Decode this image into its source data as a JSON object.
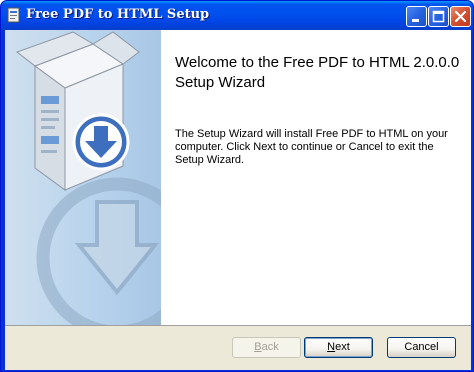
{
  "window": {
    "title": "Free PDF to HTML Setup"
  },
  "icons": {
    "app": "installer-icon",
    "minimize": "minimize-icon",
    "maximize": "maximize-icon",
    "close": "close-icon",
    "banner": "package-download-icon"
  },
  "welcome": {
    "title": "Welcome to the Free PDF to HTML 2.0.0.0 Setup Wizard",
    "body": "The Setup Wizard will install Free PDF to HTML on your computer. Click Next to continue or Cancel to exit the Setup Wizard."
  },
  "buttons": {
    "back": {
      "prefix": "",
      "mnemonic": "B",
      "rest": "ack",
      "enabled": false
    },
    "next": {
      "prefix": "",
      "mnemonic": "N",
      "rest": "ext",
      "enabled": true
    },
    "cancel": {
      "label": "Cancel"
    }
  },
  "colors": {
    "titlebar": "#0050ee",
    "side_panel": "#b8d3ec",
    "dialog_face": "#ece9d8"
  }
}
